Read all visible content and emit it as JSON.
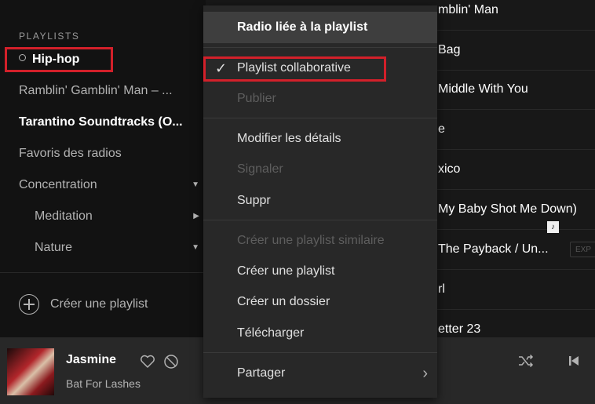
{
  "sidebar": {
    "section_label": "PLAYLISTS",
    "active_playlist": "Hip-hop",
    "items": [
      {
        "label": "Ramblin' Gamblin' Man – ...",
        "bold": false
      },
      {
        "label": "Tarantino Soundtracks (O...",
        "bold": true
      },
      {
        "label": "Favoris des radios",
        "bold": false
      },
      {
        "label": "Concentration",
        "caret": "▼"
      },
      {
        "label": "Meditation",
        "caret": "▶"
      },
      {
        "label": "Nature",
        "caret": "▼"
      }
    ],
    "create_playlist_label": "Créer une playlist"
  },
  "tracklist": {
    "visible_titles": [
      "mblin' Man",
      "Bag",
      "Middle With You",
      "e",
      "xico",
      "My Baby Shot Me Down)",
      "The Payback / Un...",
      "rl",
      "etter 23"
    ],
    "lyrics_badge": "♪",
    "explicit_badge": "EXP"
  },
  "context_menu": {
    "items": [
      {
        "label": "Radio liée à la playlist",
        "state": "hover"
      },
      {
        "label": "Playlist collaborative",
        "state": "checked"
      },
      {
        "label": "Publier",
        "state": "disabled"
      },
      {
        "label": "Modifier les détails",
        "state": "normal"
      },
      {
        "label": "Signaler",
        "state": "disabled"
      },
      {
        "label": "Suppr",
        "state": "normal"
      },
      {
        "label": "Créer une playlist similaire",
        "state": "disabled"
      },
      {
        "label": "Créer une playlist",
        "state": "normal"
      },
      {
        "label": "Créer un dossier",
        "state": "normal"
      },
      {
        "label": "Télécharger",
        "state": "normal"
      },
      {
        "label": "Partager",
        "state": "submenu"
      }
    ],
    "check_glyph": "✓",
    "submenu_glyph": "›"
  },
  "now_playing": {
    "title": "Jasmine",
    "artist": "Bat For Lashes"
  },
  "colors": {
    "highlight_box": "#d3202a",
    "background": "#121212",
    "menu_bg": "#282828"
  }
}
